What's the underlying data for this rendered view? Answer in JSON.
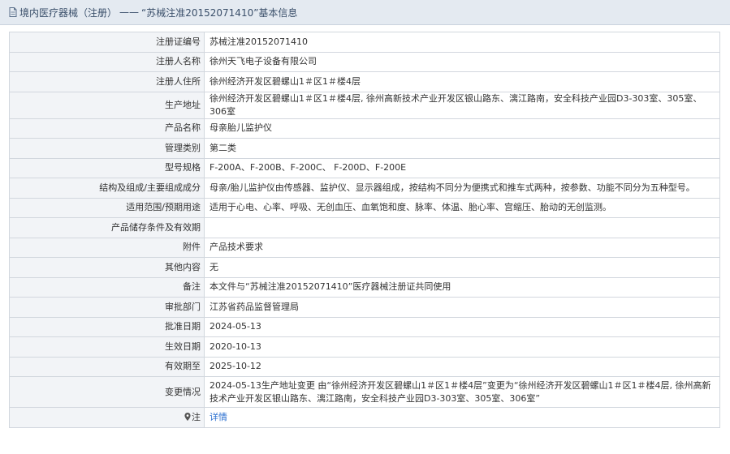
{
  "page": {
    "title_prefix": "境内医疗器械（注册）",
    "title_dash": "——",
    "title_record": "“苏械注准20152071410”基本信息"
  },
  "fields": [
    {
      "label": "注册证编号",
      "value": "苏械注准20152071410"
    },
    {
      "label": "注册人名称",
      "value": "徐州天飞电子设备有限公司"
    },
    {
      "label": "注册人住所",
      "value": "徐州经济开发区碧螺山1＃区1＃楼4层"
    },
    {
      "label": "生产地址",
      "value": "徐州经济开发区碧螺山1＃区1＃楼4层, 徐州高新技术产业开发区银山路东、漓江路南，安全科技产业园D3-303室、305室、306室"
    },
    {
      "label": "产品名称",
      "value": "母亲胎儿监护仪"
    },
    {
      "label": "管理类别",
      "value": "第二类"
    },
    {
      "label": "型号规格",
      "value": "F-200A、F-200B、F-200C、 F-200D、F-200E"
    },
    {
      "label": "结构及组成/主要组成成分",
      "value": "母亲/胎儿监护仪由传感器、监护仪、显示器组成，按结构不同分为便携式和推车式两种，按参数、功能不同分为五种型号。"
    },
    {
      "label": "适用范围/预期用途",
      "value": "适用于心电、心率、呼吸、无创血压、血氧饱和度、脉率、体温、胎心率、宫缩压、胎动的无创监测。"
    },
    {
      "label": "产品储存条件及有效期",
      "value": ""
    },
    {
      "label": "附件",
      "value": "产品技术要求"
    },
    {
      "label": "其他内容",
      "value": "无"
    },
    {
      "label": "备注",
      "value": "本文件与“苏械注准20152071410”医疗器械注册证共同使用"
    },
    {
      "label": "审批部门",
      "value": "江苏省药品监督管理局"
    },
    {
      "label": "批准日期",
      "value": "2024-05-13"
    },
    {
      "label": "生效日期",
      "value": "2020-10-13"
    },
    {
      "label": "有效期至",
      "value": "2025-10-12"
    },
    {
      "label": "变更情况",
      "value": "2024-05-13生产地址变更 由“徐州经济开发区碧螺山1＃区1＃楼4层”变更为“徐州经济开发区碧螺山1＃区1＃楼4层, 徐州高新技术产业开发区银山路东、漓江路南，安全科技产业园D3-303室、305室、306室”"
    }
  ],
  "note": {
    "label": "注",
    "link": "详情"
  },
  "icons": {
    "title": "document-icon",
    "note": "location-pin-icon"
  },
  "colors": {
    "title_bg": "#e4eaf1",
    "label_bg": "#f2f4f7",
    "border": "#d2d7de",
    "link": "#2a6fd0"
  }
}
